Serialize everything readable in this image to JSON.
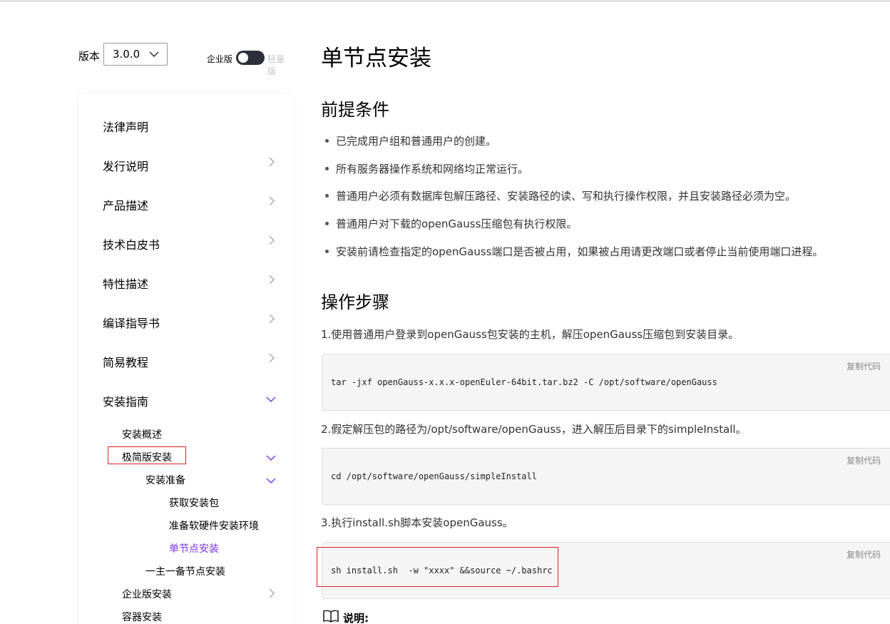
{
  "version": {
    "label": "版本",
    "selected": "3.0.0",
    "edition_enterprise": "企业版",
    "edition_lite": "轻量版"
  },
  "sidebar": {
    "items": [
      {
        "label": "法律声明"
      },
      {
        "label": "发行说明"
      },
      {
        "label": "产品描述"
      },
      {
        "label": "技术白皮书"
      },
      {
        "label": "特性描述"
      },
      {
        "label": "编译指导书"
      },
      {
        "label": "简易教程"
      },
      {
        "label": "安装指南"
      }
    ],
    "sub": {
      "overview": "安装概述",
      "lite_install": "极简版安装",
      "prep": "安装准备",
      "get_pkg": "获取安装包",
      "prep_env": "准备软硬件安装环境",
      "single_node": "单节点安装",
      "primary_standby": "一主一备节点安装",
      "enterprise_install": "企业版安装",
      "container_install": "容器安装"
    },
    "accent_color": "#7d32ea"
  },
  "main": {
    "title": "单节点安装",
    "prereq_heading": "前提条件",
    "prereqs": [
      "已完成用户组和普通用户的创建。",
      "所有服务器操作系统和网络均正常运行。",
      "普通用户必须有数据库包解压路径、安装路径的读、写和执行操作权限，并且安装路径必须为空。",
      "普通用户对下载的openGauss压缩包有执行权限。",
      "安装前请检查指定的openGauss端口是否被占用，如果被占用请更改端口或者停止当前使用端口进程。"
    ],
    "steps_heading": "操作步骤",
    "steps": [
      {
        "text": "1.使用普通用户登录到openGauss包安装的主机，解压openGauss压缩包到安装目录。",
        "code": "tar -jxf openGauss-x.x.x-openEuler-64bit.tar.bz2 -C /opt/software/openGauss"
      },
      {
        "text": "2.假定解压包的路径为/opt/software/openGauss，进入解压后目录下的simpleInstall。",
        "code": "cd /opt/software/openGauss/simpleInstall"
      },
      {
        "text": "3.执行install.sh脚本安装openGauss。",
        "code": "sh install.sh  -w \"xxxx\" &&source ~/.bashrc"
      }
    ],
    "copy_label": "复制代码",
    "note_label": "说明:"
  }
}
